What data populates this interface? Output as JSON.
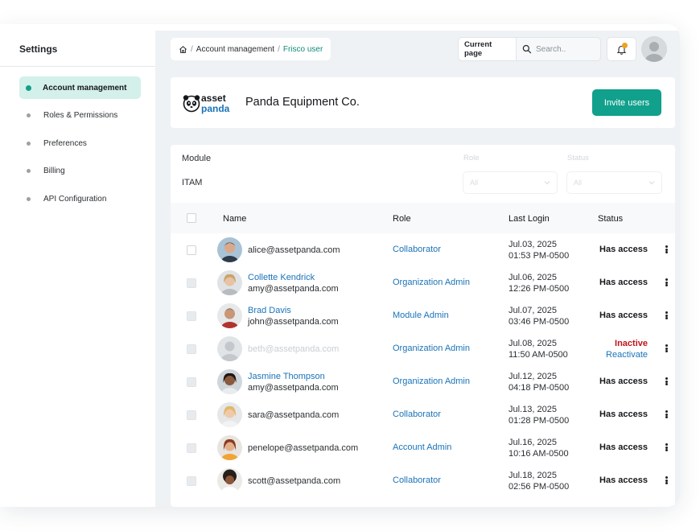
{
  "sidebar": {
    "title": "Settings",
    "items": [
      {
        "label": "Account management",
        "active": true
      },
      {
        "label": "Roles & Permissions",
        "active": false
      },
      {
        "label": "Preferences",
        "active": false
      },
      {
        "label": "Billing",
        "active": false
      },
      {
        "label": "API Configuration",
        "active": false
      }
    ]
  },
  "header": {
    "breadcrumb": {
      "parent": "Account management",
      "separator": "/",
      "current": "Frisco user"
    },
    "current_page_label": "Current page",
    "search_placeholder": "Search.."
  },
  "company": {
    "logo_text_top": "asset",
    "logo_text_bottom": "panda",
    "name": "Panda Equipment Co.",
    "invite_label": "Invite users"
  },
  "filters": {
    "module_label": "Module",
    "module_value": "ITAM",
    "role_label": "Role",
    "role_value": "All",
    "status_label": "Status",
    "status_value": "All"
  },
  "table": {
    "columns": [
      "Name",
      "Role",
      "Last Login",
      "Status"
    ],
    "rows": [
      {
        "display_name": "",
        "email": "alice@assetpanda.com",
        "role": "Collaborator",
        "login_date": "Jul.03, 2025",
        "login_time": "01:53 PM-0500",
        "status": "Has access"
      },
      {
        "display_name": "Collette Kendrick",
        "email": "amy@assetpanda.com",
        "role": "Organization Admin",
        "login_date": "Jul.06, 2025",
        "login_time": "12:26 PM-0500",
        "status": "Has access"
      },
      {
        "display_name": "Brad Davis",
        "email": "john@assetpanda.com",
        "role": "Module Admin",
        "login_date": "Jul.07, 2025",
        "login_time": "03:46 PM-0500",
        "status": "Has access"
      },
      {
        "display_name": "",
        "email": "beth@assetpanda.com",
        "role": "Organization Admin",
        "login_date": "Jul.08, 2025",
        "login_time": "11:50 AM-0500",
        "status": "Inactive",
        "action": "Reactivate"
      },
      {
        "display_name": "Jasmine Thompson",
        "email": "amy@assetpanda.com",
        "role": "Organization Admin",
        "login_date": "Jul.12, 2025",
        "login_time": "04:18 PM-0500",
        "status": "Has access"
      },
      {
        "display_name": "",
        "email": "sara@assetpanda.com",
        "role": "Collaborator",
        "login_date": "Jul.13, 2025",
        "login_time": "01:28 PM-0500",
        "status": "Has access"
      },
      {
        "display_name": "",
        "email": "penelope@assetpanda.com",
        "role": "Account Admin",
        "login_date": "Jul.16, 2025",
        "login_time": "10:16 AM-0500",
        "status": "Has access"
      },
      {
        "display_name": "",
        "email": "scott@assetpanda.com",
        "role": "Collaborator",
        "login_date": "Jul.18, 2025",
        "login_time": "02:56 PM-0500",
        "status": "Has access"
      }
    ]
  },
  "colors": {
    "accent": "#11a08c",
    "active_nav_bg": "#d4f0ea",
    "link": "#1a73b8",
    "inactive": "#c0141c",
    "notification": "#f0a020"
  },
  "icons": [
    "home-icon",
    "search-icon",
    "bell-icon",
    "kebab-menu-icon",
    "chevron-down-icon",
    "avatar-placeholder-icon"
  ]
}
